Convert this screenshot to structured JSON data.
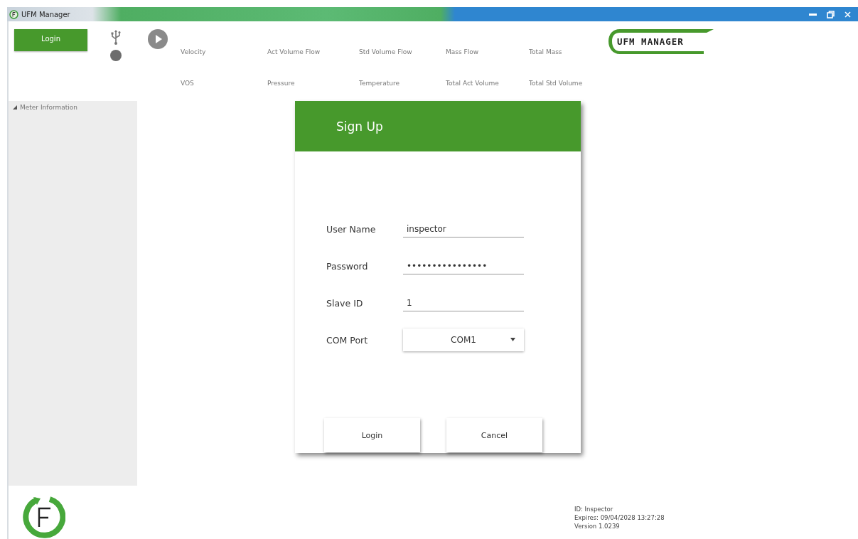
{
  "window": {
    "title": "UFM Manager"
  },
  "toolbar": {
    "login_button": "Login",
    "measurements": [
      {
        "label": "Velocity"
      },
      {
        "label": "Act Volume Flow"
      },
      {
        "label": "Std Volume Flow"
      },
      {
        "label": "Mass Flow"
      },
      {
        "label": "Total Mass"
      },
      {
        "label": "VOS"
      },
      {
        "label": "Pressure"
      },
      {
        "label": "Temperature"
      },
      {
        "label": "Total Act Volume"
      },
      {
        "label": "Total Std Volume"
      }
    ],
    "logo": "UFM MANAGER"
  },
  "sidebar": {
    "items": [
      {
        "label": "Meter Information",
        "expanded": true
      }
    ]
  },
  "dialog": {
    "title": "Sign Up",
    "fields": [
      {
        "kind": "text",
        "label": "User Name",
        "value": "inspector"
      },
      {
        "kind": "text",
        "label": "Password",
        "value": "••••••••••••••••"
      },
      {
        "kind": "text",
        "label": "Slave ID",
        "value": "1"
      },
      {
        "kind": "dropdown",
        "label": "COM Port",
        "value": "COM1"
      }
    ],
    "buttons": [
      "Login",
      "Cancel"
    ]
  },
  "footer": {
    "info": [
      "ID: Inspector",
      "Expires: 09/04/2028 13:27:28",
      "Version 1.0239"
    ]
  }
}
